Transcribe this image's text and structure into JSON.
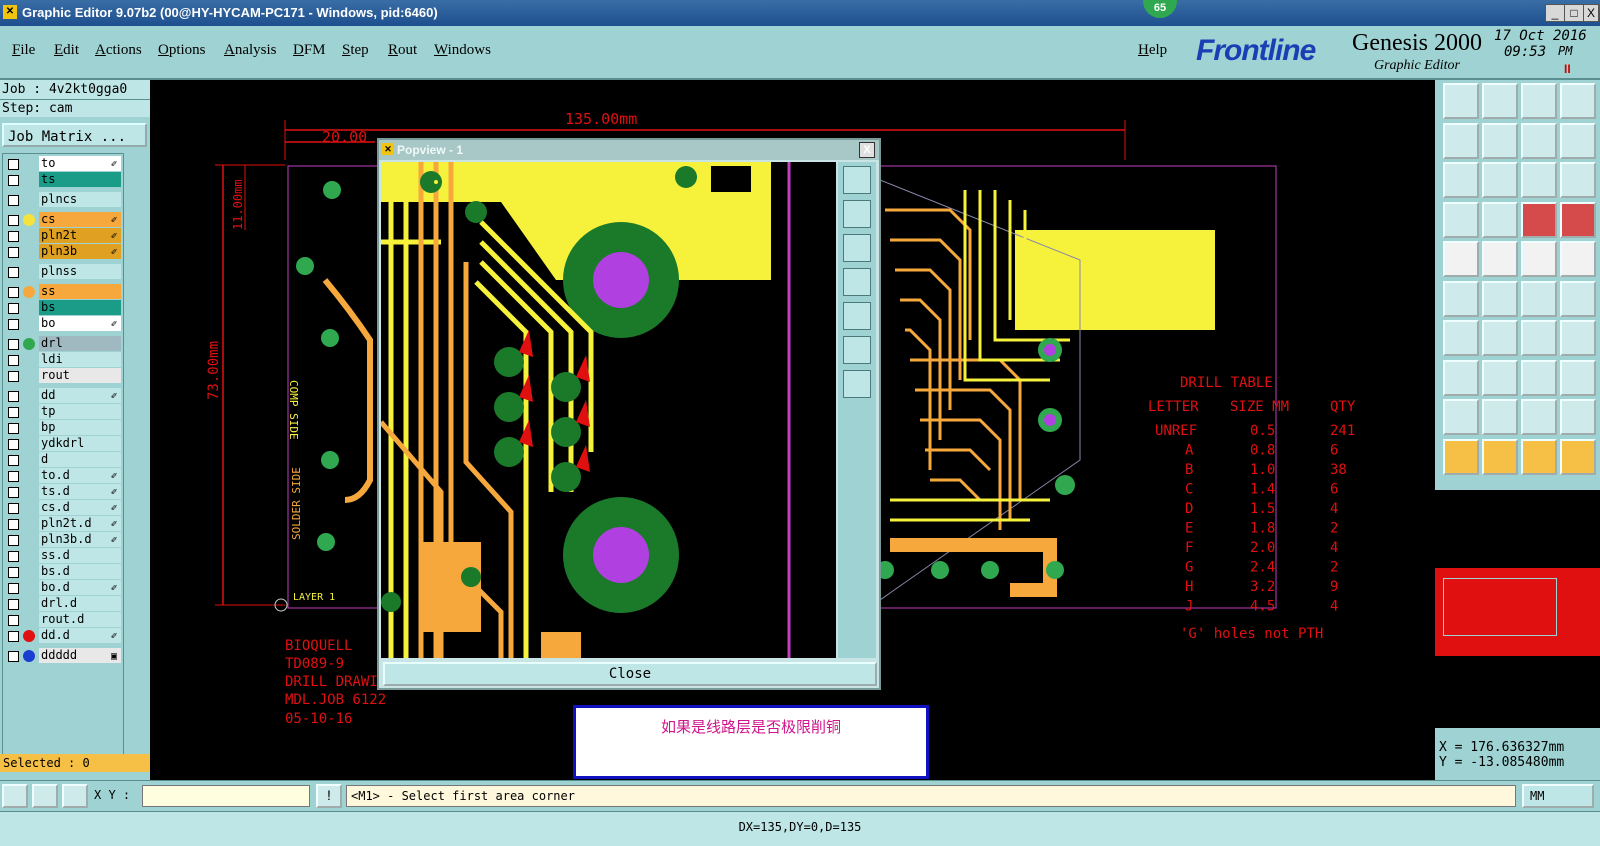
{
  "window": {
    "title": "Graphic Editor 9.07b2 (00@HY-HYCAM-PC171 - Windows, pid:6460)",
    "badge": "65",
    "minimize": "_",
    "maximize": "□",
    "close": "X"
  },
  "menu": {
    "items": [
      "File",
      "Edit",
      "Actions",
      "Options",
      "Analysis",
      "DFM",
      "Step",
      "Rout",
      "Windows"
    ],
    "help": "Help"
  },
  "brand": {
    "logo": "Frontline",
    "product": "Genesis 2000",
    "subtitle": "Graphic Editor",
    "date": "17 Oct 2016",
    "time": "09:53",
    "ampm": "PM",
    "indicator": "II"
  },
  "job": {
    "job_line": "Job : 4v2kt0gga0",
    "step_line": "Step: cam",
    "matrix_button": "Job Matrix ..."
  },
  "layers": [
    {
      "name": "to",
      "bg": "#ffffff",
      "dot": "",
      "mark": "✐"
    },
    {
      "name": "ts",
      "bg": "#1a9c88",
      "dot": "",
      "mark": ""
    },
    {
      "name": "plncs",
      "bg": "#bfe6e6",
      "dot": "",
      "mark": ""
    },
    {
      "name": "cs",
      "bg": "#f6a83c",
      "dot": "#f6e23c",
      "mark": "✐"
    },
    {
      "name": "pln2t",
      "bg": "#e0a022",
      "dot": "",
      "mark": "✐"
    },
    {
      "name": "pln3b",
      "bg": "#e0a022",
      "dot": "",
      "mark": "✐"
    },
    {
      "name": "plnss",
      "bg": "#bfe6e6",
      "dot": "",
      "mark": ""
    },
    {
      "name": "ss",
      "bg": "#f6a83c",
      "dot": "#f6a83c",
      "mark": ""
    },
    {
      "name": "bs",
      "bg": "#1a9c88",
      "dot": "",
      "mark": ""
    },
    {
      "name": "bo",
      "bg": "#ffffff",
      "dot": "",
      "mark": "✐"
    },
    {
      "name": "drl",
      "bg": "#a0b8c0",
      "dot": "#2fa84f",
      "mark": ""
    },
    {
      "name": "ldi",
      "bg": "#bfe6e6",
      "dot": "",
      "mark": ""
    },
    {
      "name": "rout",
      "bg": "#e8e8e8",
      "dot": "",
      "mark": ""
    },
    {
      "name": "dd",
      "bg": "#bfe6e6",
      "dot": "",
      "mark": "✐"
    },
    {
      "name": "tp",
      "bg": "#bfe6e6",
      "dot": "",
      "mark": ""
    },
    {
      "name": "bp",
      "bg": "#bfe6e6",
      "dot": "",
      "mark": ""
    },
    {
      "name": "ydkdrl",
      "bg": "#bfe6e6",
      "dot": "",
      "mark": ""
    },
    {
      "name": "d",
      "bg": "#bfe6e6",
      "dot": "",
      "mark": ""
    },
    {
      "name": "to.d",
      "bg": "#bfe6e6",
      "dot": "",
      "mark": "✐"
    },
    {
      "name": "ts.d",
      "bg": "#bfe6e6",
      "dot": "",
      "mark": "✐"
    },
    {
      "name": "cs.d",
      "bg": "#bfe6e6",
      "dot": "",
      "mark": "✐"
    },
    {
      "name": "pln2t.d",
      "bg": "#bfe6e6",
      "dot": "",
      "mark": "✐"
    },
    {
      "name": "pln3b.d",
      "bg": "#bfe6e6",
      "dot": "",
      "mark": "✐"
    },
    {
      "name": "ss.d",
      "bg": "#bfe6e6",
      "dot": "",
      "mark": ""
    },
    {
      "name": "bs.d",
      "bg": "#bfe6e6",
      "dot": "",
      "mark": ""
    },
    {
      "name": "bo.d",
      "bg": "#bfe6e6",
      "dot": "",
      "mark": "✐"
    },
    {
      "name": "drl.d",
      "bg": "#bfe6e6",
      "dot": "",
      "mark": ""
    },
    {
      "name": "rout.d",
      "bg": "#bfe6e6",
      "dot": "",
      "mark": ""
    },
    {
      "name": "dd.d",
      "bg": "#bfe6e6",
      "dot": "#e01010",
      "mark": "✐"
    },
    {
      "name": "ddddd",
      "bg": "#e8e8e8",
      "dot": "#1a3fd0",
      "mark": "▣"
    }
  ],
  "selected": "Selected : 0",
  "drawing": {
    "dim_top": "135.00mm",
    "dim_left": "20.00",
    "dim_height": "73.00mm",
    "dim_small": "11.00mm",
    "comp_side": "COMP SIDE",
    "solder_side": "SOLDER SIDE",
    "layer_label": "LAYER 1",
    "title_block": [
      "BIOQUELL",
      "TD089-9",
      "DRILL DRAWING",
      "MDL.JOB 6122",
      "05-10-16"
    ],
    "drill_table_title": "DRILL TABLE",
    "drill_table_headers": [
      "LETTER",
      "SIZE MM",
      "QTY"
    ],
    "drill_table_rows": [
      [
        "UNREF",
        "0.5",
        "241"
      ],
      [
        "A",
        "0.8",
        "6"
      ],
      [
        "B",
        "1.0",
        "38"
      ],
      [
        "C",
        "1.4",
        "6"
      ],
      [
        "D",
        "1.5",
        "4"
      ],
      [
        "E",
        "1.8",
        "2"
      ],
      [
        "F",
        "2.0",
        "4"
      ],
      [
        "G",
        "2.4",
        "2"
      ],
      [
        "H",
        "3.2",
        "9"
      ],
      [
        "J",
        "4.5",
        "4"
      ]
    ],
    "drill_note": "'G' holes not PTH"
  },
  "popview": {
    "title": "Popview - 1",
    "close_label": "Close",
    "close_x": "X"
  },
  "note": "如果是线路层是否极限削铜",
  "coords": {
    "x": "X =  176.636327mm",
    "y": "Y =  -13.085480mm"
  },
  "bottom": {
    "xy_label": "X Y :",
    "prompt": "<M1> - Select first area corner",
    "units": "MM",
    "bang": "!"
  },
  "status": "DX=135,DY=0,D=135",
  "colors": {
    "panel": "#9fd3d3",
    "trace_yellow": "#f6f23c",
    "trace_orange": "#f6a83c",
    "pad_green": "#2fa84f",
    "dim_red": "#e01010"
  }
}
